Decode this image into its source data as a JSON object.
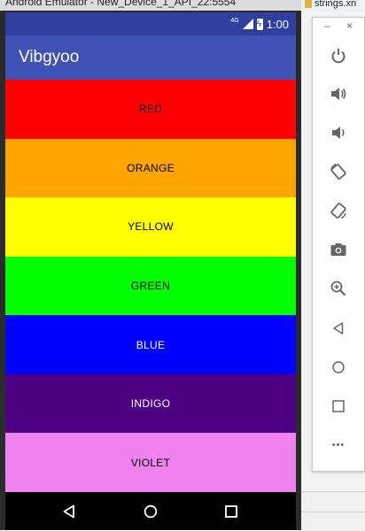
{
  "window": {
    "title": "Android Emulator - New_Device_1_API_22:5554",
    "ide_tab": "strings.xn"
  },
  "status_bar": {
    "network": "4G",
    "time": "1:00"
  },
  "app": {
    "title": "Vibgyoo"
  },
  "colors": [
    {
      "label": "RED",
      "bg": "#ff0000",
      "fg": "#000000"
    },
    {
      "label": "ORANGE",
      "bg": "#ffa500",
      "fg": "#000000"
    },
    {
      "label": "YELLOW",
      "bg": "#ffff00",
      "fg": "#000000"
    },
    {
      "label": "GREEN",
      "bg": "#00ff00",
      "fg": "#000000"
    },
    {
      "label": "BLUE",
      "bg": "#0000ff",
      "fg": "#ffffff"
    },
    {
      "label": "INDIGO",
      "bg": "#4b0082",
      "fg": "#ffffff"
    },
    {
      "label": "VIOLET",
      "bg": "#ee82ee",
      "fg": "#000000"
    }
  ],
  "nav_bar": {
    "buttons": [
      "back-icon",
      "home-icon",
      "recents-icon"
    ]
  },
  "toolbar": {
    "minimize": "–",
    "close": "×",
    "buttons": [
      "power-icon",
      "volume-up-icon",
      "volume-down-icon",
      "rotate-left-icon",
      "rotate-right-icon",
      "camera-icon",
      "zoom-icon",
      "back-icon",
      "home-icon",
      "overview-icon",
      "more-icon"
    ],
    "more": "•••"
  },
  "theme": {
    "primary": "#3f51b5",
    "primary_dark": "#303f9f"
  }
}
